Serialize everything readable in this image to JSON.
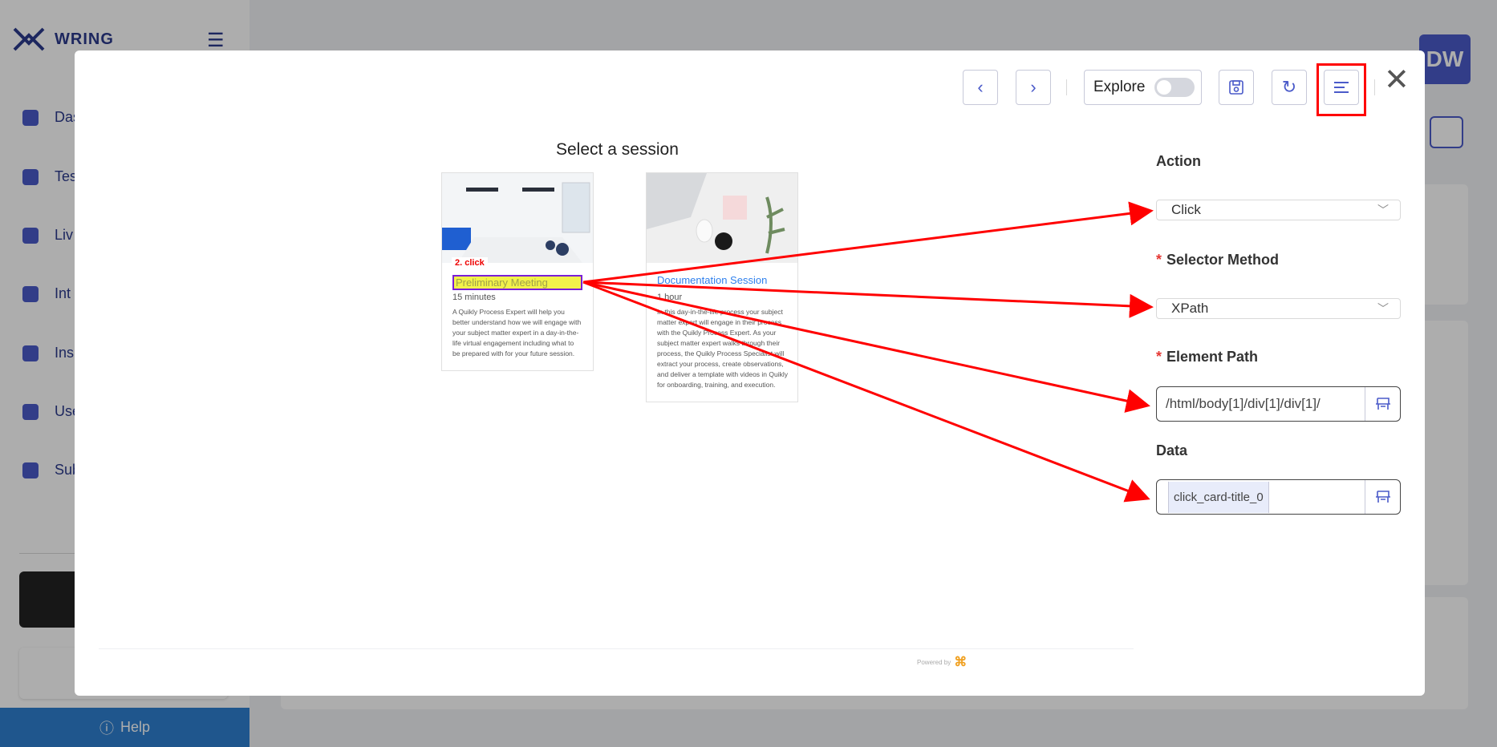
{
  "app": {
    "name": "WRING",
    "avatar_initials": "DW",
    "sidebar_items": [
      {
        "label": "Das",
        "icon": "pie-chart-icon"
      },
      {
        "label": "Tes",
        "icon": "list-icon"
      },
      {
        "label": "Liv",
        "icon": "bulb-icon"
      },
      {
        "label": "Int",
        "icon": "cube-icon"
      },
      {
        "label": "Ins",
        "icon": "gear-icon"
      },
      {
        "label": "Use",
        "icon": "user-icon"
      },
      {
        "label": "Sub",
        "icon": "briefcase-icon"
      }
    ],
    "help_label": "Help"
  },
  "toolbar": {
    "explore_label": "Explore",
    "explore_enabled": false
  },
  "preview": {
    "title": "Select a session",
    "click_annotation": "2. click",
    "cards": [
      {
        "title": "Preliminary Meeting",
        "duration": "15 minutes",
        "description": "A Quikly Process Expert will help you better understand how we will engage with your subject matter expert in a day-in-the-life virtual engagement including what to be prepared with for your future session."
      },
      {
        "title": "Documentation Session",
        "duration": "1 hour",
        "description": "In this day-in-the-life process your subject matter expert will engage in their process with the Quikly Process Expert. As your subject matter expert walks through their process, the Quikly Process Specialist will extract your process, create observations, and deliver a template with videos in Quikly for onboarding, training, and execution."
      }
    ],
    "powered_by": "Powered by"
  },
  "form": {
    "action_label": "Action",
    "action_value": "Click",
    "selector_label": "Selector Method",
    "selector_value": "XPath",
    "path_label": "Element Path",
    "path_value": "/html/body[1]/div[1]/div[1]/",
    "data_label": "Data",
    "data_value": "click_card-title_0",
    "required_mark": "*"
  },
  "colors": {
    "accent": "#4a5ac9",
    "annotation_red": "#ff0000",
    "link_blue": "#2f80ed"
  }
}
